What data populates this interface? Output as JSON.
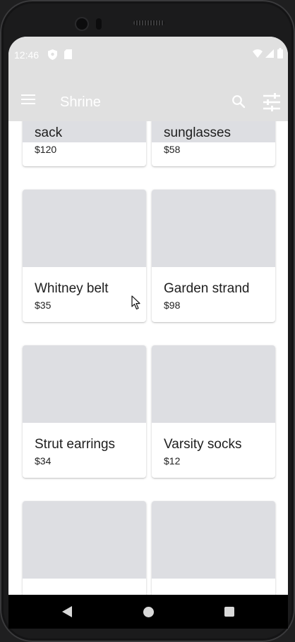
{
  "status_bar": {
    "time": "12:46",
    "icons": [
      "shield-icon",
      "sd-card-icon",
      "wifi-icon",
      "signal-icon",
      "battery-icon"
    ]
  },
  "app_bar": {
    "title": "Shrine",
    "icons": [
      "menu-icon",
      "search-icon",
      "tune-icon"
    ]
  },
  "products": [
    {
      "name": "sack",
      "price": "$120"
    },
    {
      "name": "sunglasses",
      "price": "$58"
    },
    {
      "name": "Whitney belt",
      "price": "$35"
    },
    {
      "name": "Garden strand",
      "price": "$98"
    },
    {
      "name": "Strut earrings",
      "price": "$34"
    },
    {
      "name": "Varsity socks",
      "price": "$12"
    },
    {
      "name": "",
      "price": ""
    },
    {
      "name": "",
      "price": ""
    }
  ],
  "colors": {
    "app_bar": "#e0e0e0",
    "image_placeholder": "#dddee2",
    "card": "#ffffff"
  },
  "nav_bar": {
    "icons": [
      "back-icon",
      "home-icon",
      "recents-icon"
    ]
  }
}
